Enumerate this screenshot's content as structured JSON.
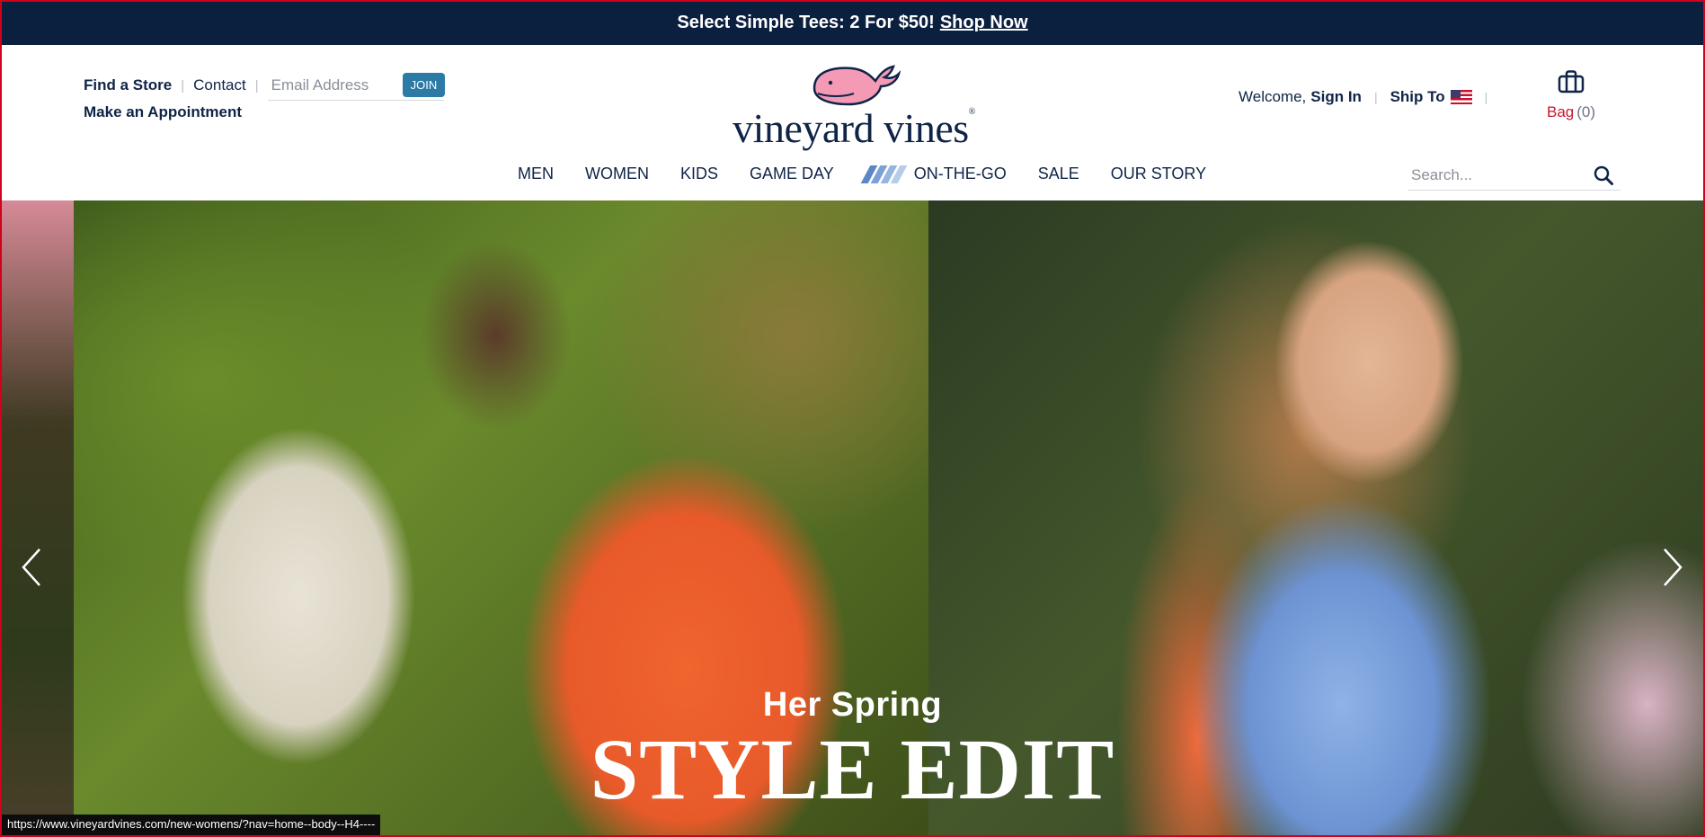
{
  "promo": {
    "text": "Select Simple Tees: 2 For $50!",
    "link": "Shop Now"
  },
  "utility_left": {
    "find_store": "Find a Store",
    "contact": "Contact",
    "email_placeholder": "Email Address",
    "join": "JOIN",
    "appointment": "Make an Appointment"
  },
  "logo": {
    "text": "vineyard vines",
    "mark": "®",
    "icon": "whale-logo-icon"
  },
  "utility_right": {
    "welcome": "Welcome,",
    "sign_in": "Sign In",
    "ship_to": "Ship To",
    "flag_icon": "us-flag-icon",
    "bag_label": "Bag",
    "bag_count": "(0)"
  },
  "nav": {
    "items": [
      {
        "label": "MEN"
      },
      {
        "label": "WOMEN"
      },
      {
        "label": "KIDS"
      },
      {
        "label": "GAME DAY"
      },
      {
        "label": "ON-THE-GO"
      },
      {
        "label": "SALE"
      },
      {
        "label": "OUR STORY"
      }
    ]
  },
  "search": {
    "placeholder": "Search..."
  },
  "hero": {
    "subtitle": "Her Spring",
    "title": "STYLE EDIT"
  },
  "status_bar": {
    "url": "https://www.vineyardvines.com/new-womens/?nav=home--body--H4----"
  },
  "colors": {
    "promo_bg": "#0b1f3f",
    "navy": "#0f2447",
    "join_bg": "#2c7aa6",
    "bag_red": "#c5172e",
    "whale_pink": "#f49ab4"
  }
}
